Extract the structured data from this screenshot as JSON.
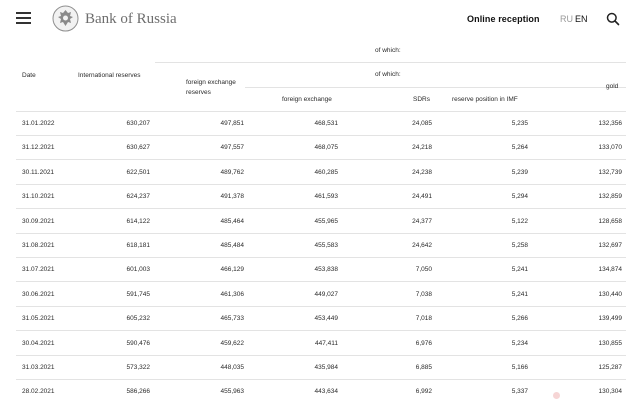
{
  "header": {
    "brand": "Bank of Russia",
    "online_reception": "Online reception",
    "lang_ru": "RU",
    "lang_en": "EN",
    "icons": [
      "menu-icon",
      "bank-emblem-logo",
      "search-icon"
    ]
  },
  "table": {
    "of_which_1": "of which:",
    "of_which_2": "of which:",
    "columns": {
      "date": "Date",
      "international_reserves": "International reserves",
      "fx_reserves": "foreign exchange reserves",
      "foreign_exchange": "foreign exchange",
      "sdrs": "SDRs",
      "reserve_position_imf": "reserve position in IMF",
      "gold": "gold"
    },
    "rows": [
      [
        "31.01.2022",
        "630,207",
        "497,851",
        "468,531",
        "24,085",
        "5,235",
        "132,356"
      ],
      [
        "31.12.2021",
        "630,627",
        "497,557",
        "468,075",
        "24,218",
        "5,264",
        "133,070"
      ],
      [
        "30.11.2021",
        "622,501",
        "489,762",
        "460,285",
        "24,238",
        "5,239",
        "132,739"
      ],
      [
        "31.10.2021",
        "624,237",
        "491,378",
        "461,593",
        "24,491",
        "5,294",
        "132,859"
      ],
      [
        "30.09.2021",
        "614,122",
        "485,464",
        "455,965",
        "24,377",
        "5,122",
        "128,658"
      ],
      [
        "31.08.2021",
        "618,181",
        "485,484",
        "455,583",
        "24,642",
        "5,258",
        "132,697"
      ],
      [
        "31.07.2021",
        "601,003",
        "466,129",
        "453,838",
        "7,050",
        "5,241",
        "134,874"
      ],
      [
        "30.06.2021",
        "591,745",
        "461,306",
        "449,027",
        "7,038",
        "5,241",
        "130,440"
      ],
      [
        "31.05.2021",
        "605,232",
        "465,733",
        "453,449",
        "7,018",
        "5,266",
        "139,499"
      ],
      [
        "30.04.2021",
        "590,476",
        "459,622",
        "447,411",
        "6,976",
        "5,234",
        "130,855"
      ],
      [
        "31.03.2021",
        "573,322",
        "448,035",
        "435,984",
        "6,885",
        "5,166",
        "125,287"
      ],
      [
        "28.02.2021",
        "586,266",
        "455,963",
        "443,634",
        "6,992",
        "5,337",
        "130,304"
      ]
    ]
  }
}
